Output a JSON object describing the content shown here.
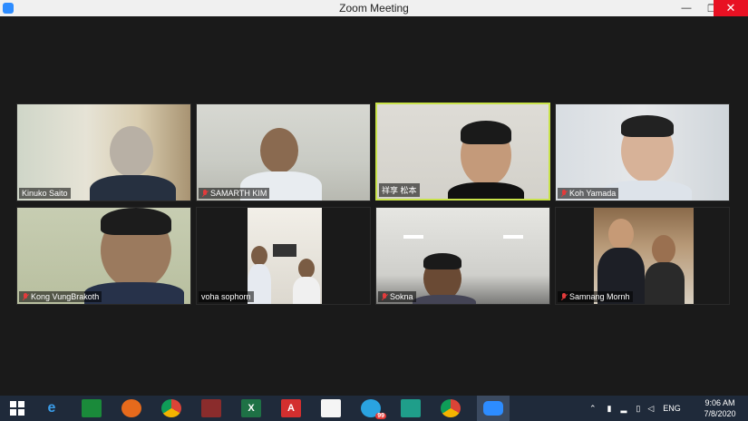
{
  "window": {
    "title": "Zoom Meeting",
    "minimize_glyph": "—",
    "maximize_glyph": "❐",
    "close_glyph": "✕"
  },
  "participants": [
    {
      "name": "Kinuko Saito",
      "muted": false
    },
    {
      "name": "SAMARTH KIM",
      "muted": true
    },
    {
      "name": "祥享 松本",
      "muted": false,
      "active_speaker": true
    },
    {
      "name": "Koh Yamada",
      "muted": true
    },
    {
      "name": "Kong VungBrakoth",
      "muted": true
    },
    {
      "name": "voha sophorn",
      "muted": false
    },
    {
      "name": "Sokna",
      "muted": true
    },
    {
      "name": "Samnang Mornh",
      "muted": true
    }
  ],
  "taskbar": {
    "apps": [
      {
        "icon": "windows-start-icon"
      },
      {
        "icon": "internet-explorer-icon"
      },
      {
        "icon": "store-icon"
      },
      {
        "icon": "firefox-icon"
      },
      {
        "icon": "chrome-icon"
      },
      {
        "icon": "book-icon"
      },
      {
        "icon": "excel-icon",
        "label": "X"
      },
      {
        "icon": "acrobat-icon",
        "label": "A"
      },
      {
        "icon": "pdf-icon"
      },
      {
        "icon": "telegram-icon",
        "badge": "99"
      },
      {
        "icon": "app-icon"
      },
      {
        "icon": "chrome-icon"
      },
      {
        "icon": "zoom-icon"
      }
    ],
    "language": "ENG",
    "time": "9:06 AM",
    "date": "7/8/2020"
  }
}
